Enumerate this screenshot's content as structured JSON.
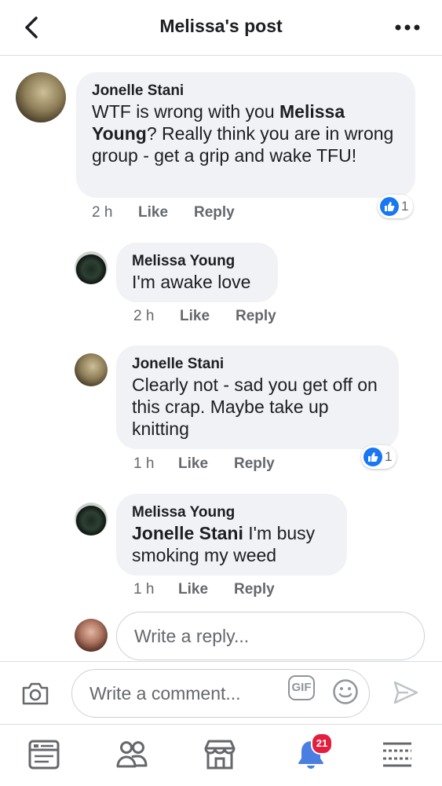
{
  "header": {
    "title": "Melissa's post"
  },
  "comments": [
    {
      "author": "Jonelle Stani",
      "text_parts": [
        "WTF is wrong with you ",
        "Melissa Young",
        "? Really think you are in wrong group - get a grip and wake TFU!"
      ],
      "time": "2 h",
      "like_label": "Like",
      "reply_label": "Reply",
      "reactions": "1"
    }
  ],
  "replies": [
    {
      "author": "Melissa Young",
      "text": "I'm awake love",
      "time": "2 h",
      "like_label": "Like",
      "reply_label": "Reply"
    },
    {
      "author": "Jonelle Stani",
      "text": "Clearly not - sad you get off on this crap. Maybe take up knitting",
      "time": "1 h",
      "like_label": "Like",
      "reply_label": "Reply",
      "reactions": "1"
    },
    {
      "author": "Melissa Young",
      "mention": "Jonelle Stani",
      "text": " I'm busy smoking my weed",
      "time": "1 h",
      "like_label": "Like",
      "reply_label": "Reply"
    }
  ],
  "reply_box": {
    "placeholder": "Write a reply..."
  },
  "composer": {
    "placeholder": "Write a comment...",
    "gif_label": "GIF"
  },
  "nav": {
    "items": [
      "news-feed",
      "groups",
      "marketplace",
      "notifications",
      "menu"
    ],
    "notification_badge": "21"
  },
  "colors": {
    "accent": "#1877f2",
    "bubble": "#f0f2f5",
    "meta": "#65676b",
    "badge": "#e41e3f"
  }
}
